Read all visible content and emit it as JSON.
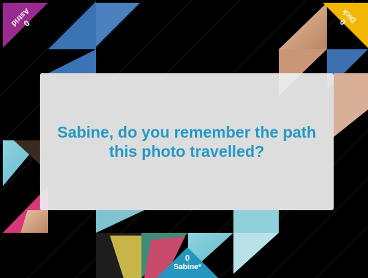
{
  "prompt": {
    "text": "Sabine, do you remember the path this photo travelled?"
  },
  "players": [
    {
      "name": "Astrid",
      "score": "0",
      "color": "#9b2a8f",
      "corner": "top-left"
    },
    {
      "name": "Dick",
      "score": "0",
      "color": "#f2b705",
      "corner": "top-right"
    },
    {
      "name": "Sabine*",
      "score": "0",
      "color": "#2596be",
      "corner": "bottom-center"
    }
  ],
  "colors": {
    "background": "#000000",
    "accent_blue": "#3a74b5",
    "overlay": "#eeeeee",
    "prompt_text": "#2399c4"
  }
}
